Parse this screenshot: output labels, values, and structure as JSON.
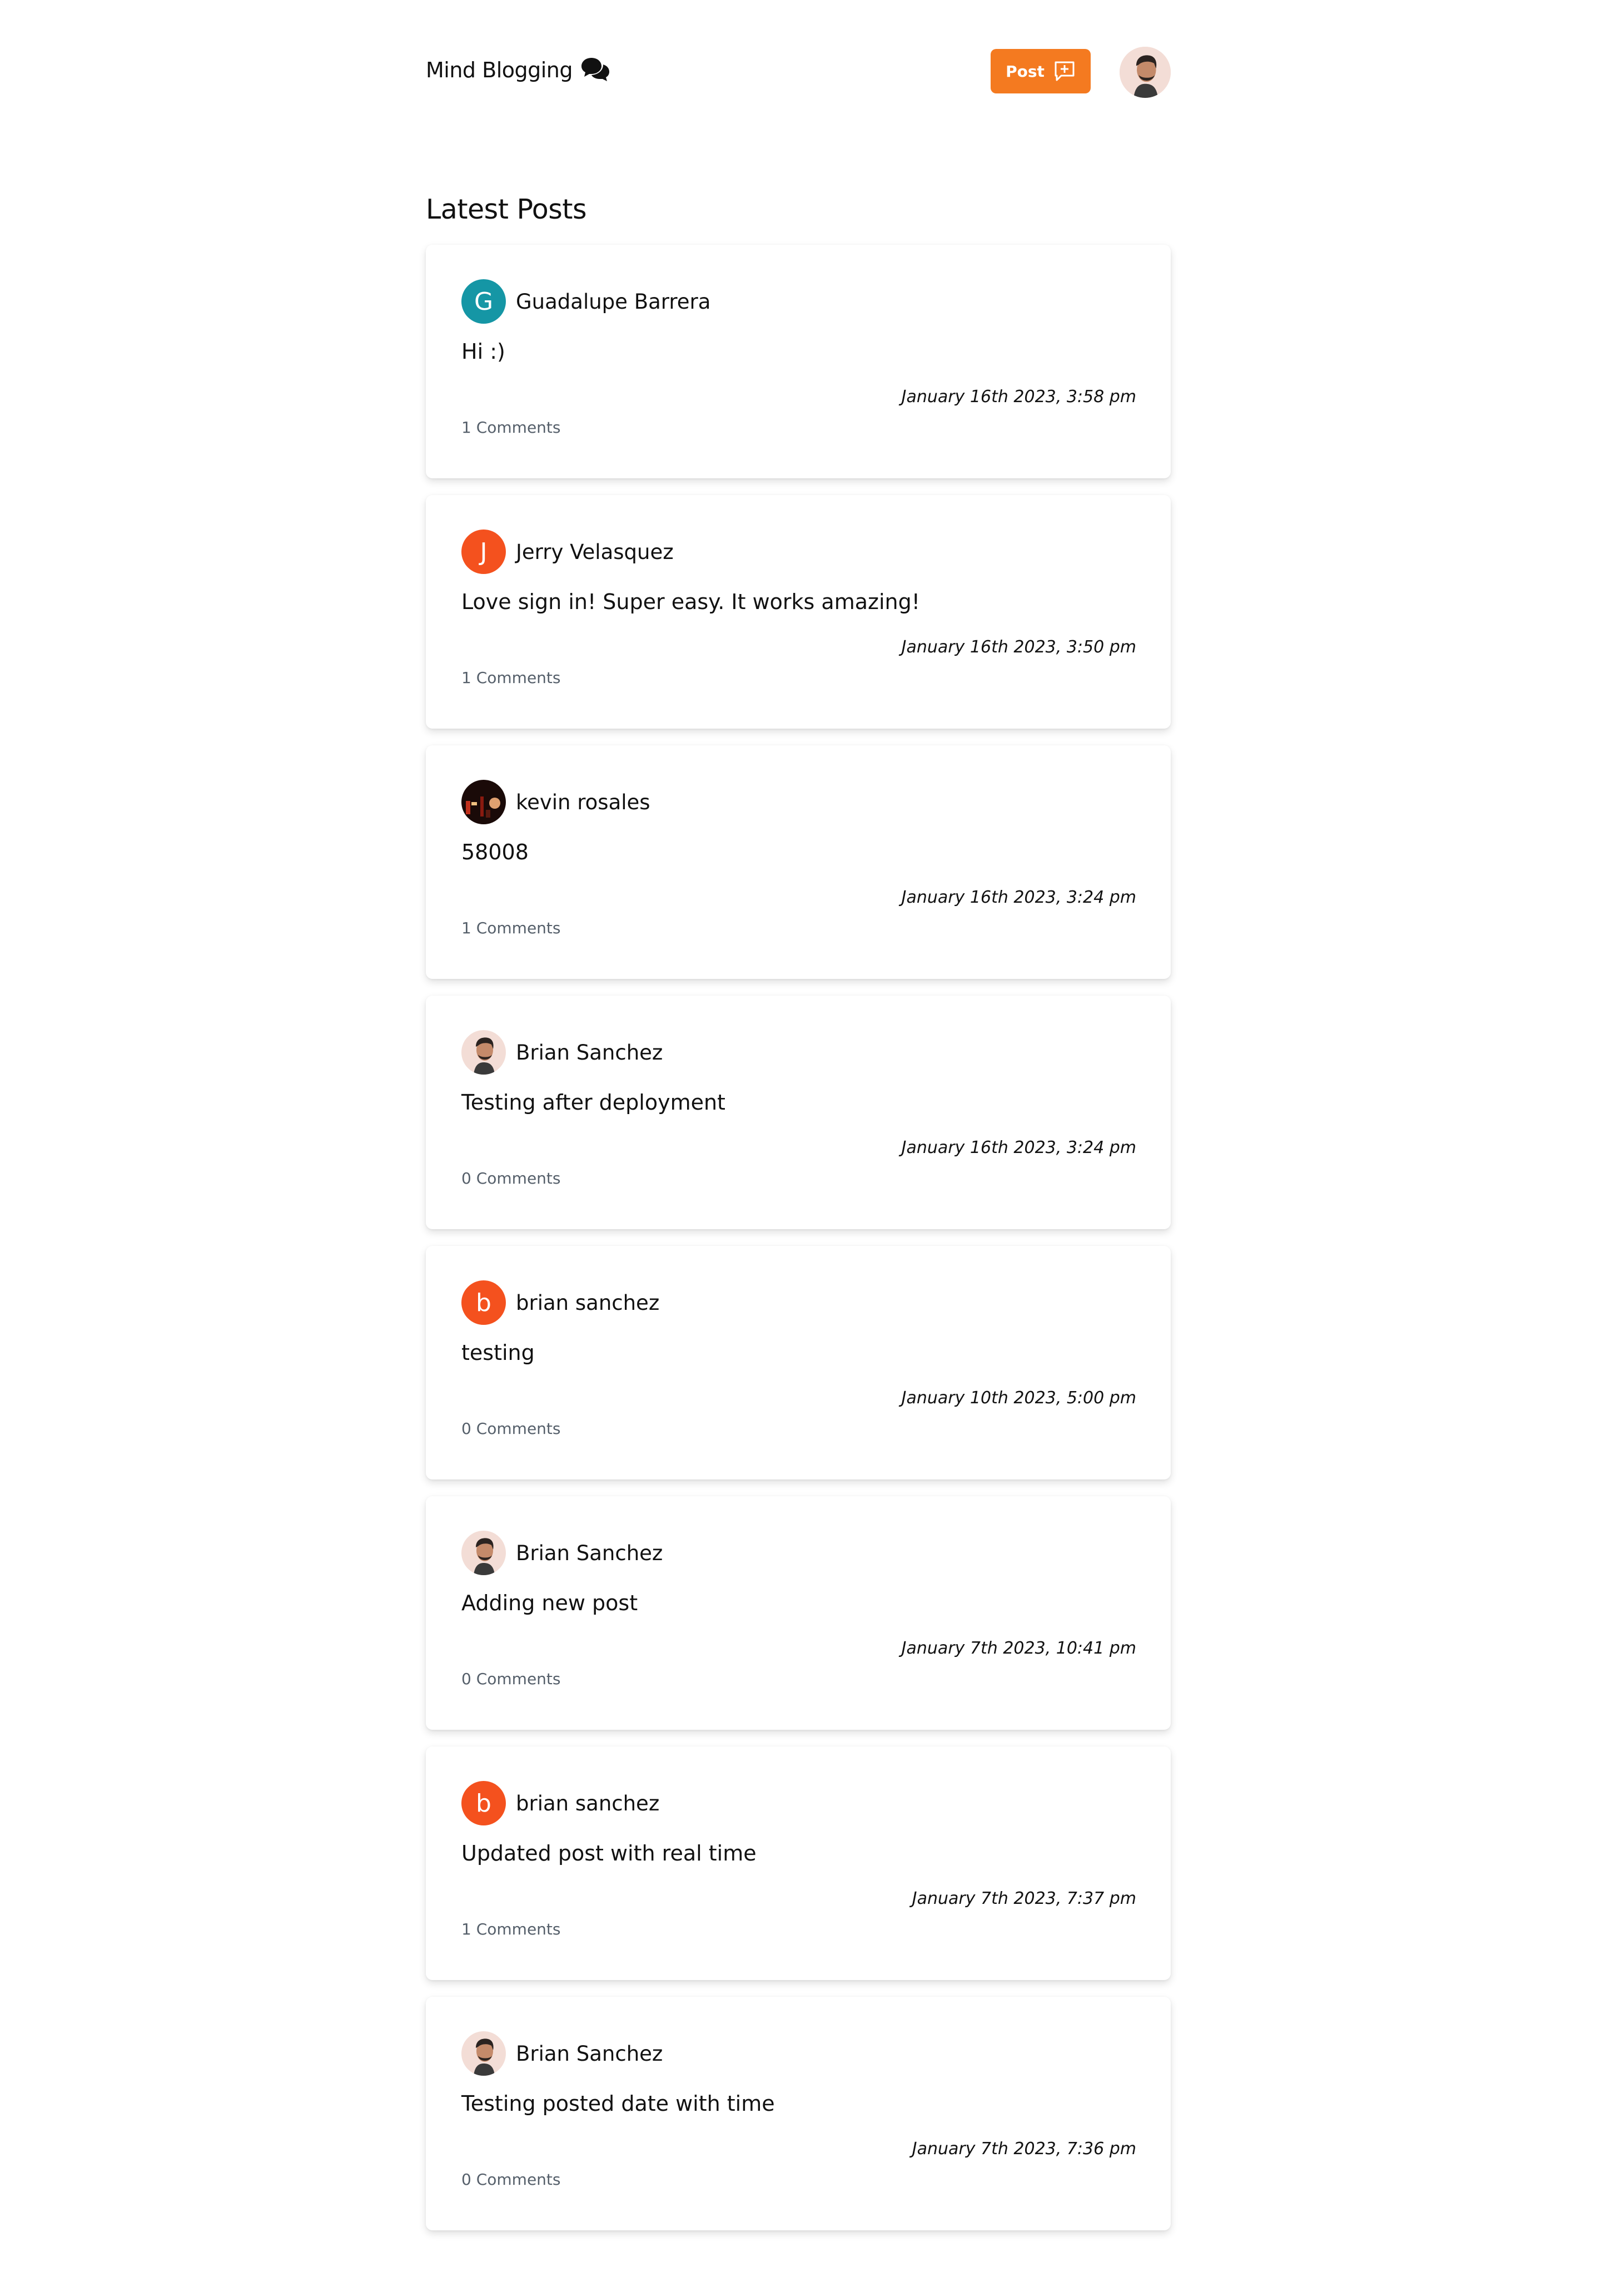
{
  "header": {
    "brand": "Mind Blogging",
    "post_button_label": "Post"
  },
  "section_title": "Latest Posts",
  "posts": [
    {
      "author": "Guadalupe Barrera",
      "avatar_type": "letter",
      "letter": "G",
      "color": "#1596a5",
      "content": "Hi :)",
      "date": "January 16th 2023, 3:58 pm",
      "comments": "1 Comments"
    },
    {
      "author": "Jerry Velasquez",
      "avatar_type": "letter",
      "letter": "J",
      "color": "#f4511e",
      "content": "Love sign in! Super easy. It works amazing!",
      "date": "January 16th 2023, 3:50 pm",
      "comments": "1 Comments"
    },
    {
      "author": "kevin rosales",
      "avatar_type": "photo-dark",
      "content": "58008",
      "date": "January 16th 2023, 3:24 pm",
      "comments": "1 Comments"
    },
    {
      "author": "Brian Sanchez",
      "avatar_type": "photo",
      "content": "Testing after deployment",
      "date": "January 16th 2023, 3:24 pm",
      "comments": "0 Comments"
    },
    {
      "author": "brian sanchez",
      "avatar_type": "letter",
      "letter": "b",
      "color": "#f4511e",
      "content": "testing",
      "date": "January 10th 2023, 5:00 pm",
      "comments": "0 Comments"
    },
    {
      "author": "Brian Sanchez",
      "avatar_type": "photo",
      "content": "Adding new post",
      "date": "January 7th 2023, 10:41 pm",
      "comments": "0 Comments"
    },
    {
      "author": "brian sanchez",
      "avatar_type": "letter",
      "letter": "b",
      "color": "#f4511e",
      "content": "Updated post with real time",
      "date": "January 7th 2023, 7:37 pm",
      "comments": "1 Comments"
    },
    {
      "author": "Brian Sanchez",
      "avatar_type": "photo",
      "content": "Testing posted date with time",
      "date": "January 7th 2023, 7:36 pm",
      "comments": "0 Comments"
    }
  ],
  "colors": {
    "accent": "#f47a20"
  }
}
